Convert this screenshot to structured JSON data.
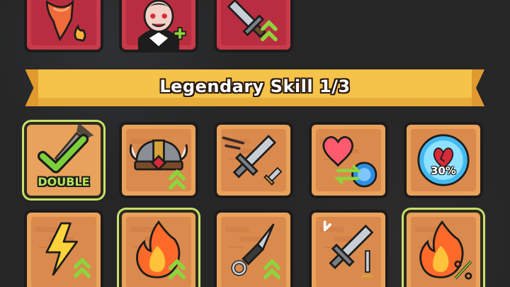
{
  "banner": {
    "title": "Legendary Skill 1/3"
  },
  "top_row": [
    {
      "name": "fire-tornado-skill",
      "icon": "fire-tornado-icon"
    },
    {
      "name": "vampire-heal-skill",
      "icon": "vampire-plus-icon"
    },
    {
      "name": "sword-upgrade-skill",
      "icon": "sword-arrows-icon"
    }
  ],
  "skills_row1": [
    {
      "name": "double-skill",
      "icon": "checkmark-icon",
      "label": "DOUBLE",
      "selected": true
    },
    {
      "name": "viking-helmet-skill",
      "icon": "viking-helmet-icon"
    },
    {
      "name": "sword-dash-skill",
      "icon": "sword-dash-icon"
    },
    {
      "name": "heart-swap-skill",
      "icon": "heart-swap-icon"
    },
    {
      "name": "heart-shield-skill",
      "icon": "heart-bubble-icon",
      "label": "30%"
    }
  ],
  "skills_row2": [
    {
      "name": "lightning-skill",
      "icon": "lightning-icon"
    },
    {
      "name": "fire-up-skill",
      "icon": "fire-icon"
    },
    {
      "name": "kunai-skill",
      "icon": "kunai-icon"
    },
    {
      "name": "sword-split-skill",
      "icon": "sword-split-icon"
    },
    {
      "name": "fire-percent-skill",
      "icon": "fire-percent-icon"
    }
  ],
  "colors": {
    "card_orange": "#e9a25c",
    "card_red": "#c93a4b",
    "banner_yellow": "#f5c34a",
    "upgrade_green": "#8ed43c",
    "selected_glow": "#c9e06a"
  }
}
